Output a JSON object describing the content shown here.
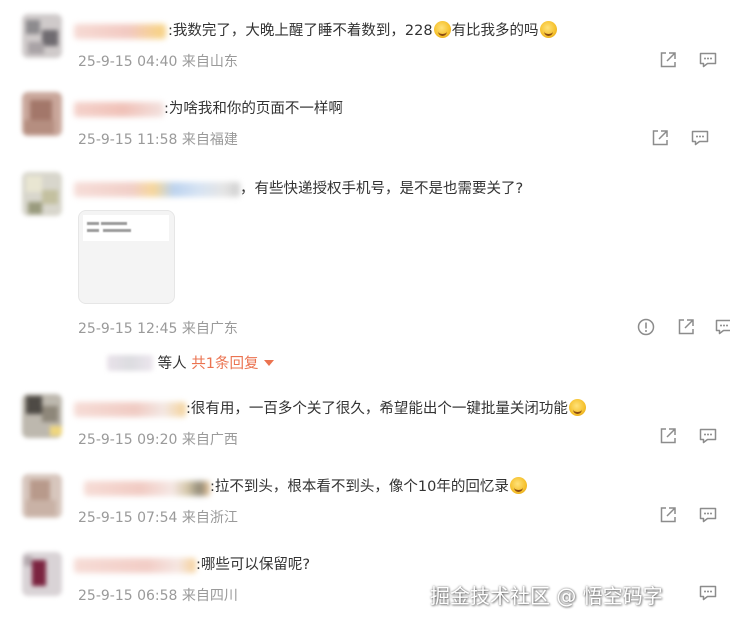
{
  "comments": [
    {
      "text": ":我数完了，大晚上醒了睡不着数到，228",
      "text_after_emoji": "有比我多的吗",
      "timestamp": "25-9-15 04:40",
      "location": "来自山东"
    },
    {
      "text": ":为啥我和你的页面不一样啊",
      "timestamp": "25-9-15 11:58",
      "location": "来自福建"
    },
    {
      "text": "，有些快递授权手机号，是不是也需要关了?",
      "timestamp": "25-9-15 12:45",
      "location": "来自广东"
    },
    {
      "text": ":很有用，一百多个关了很久，希望能出个一键批量关闭功能",
      "timestamp": "25-9-15 09:20",
      "location": "来自广西"
    },
    {
      "text": ":拉不到头，根本看不到头，像个10年的回忆录",
      "timestamp": "25-9-15 07:54",
      "location": "来自浙江"
    },
    {
      "text": ":哪些可以保留呢?",
      "timestamp": "25-9-15 06:58",
      "location": "来自四川"
    }
  ],
  "replies": {
    "prefix": "等人",
    "link": "共1条回复"
  },
  "watermark": "掘金技术社区 @ 悟空码字",
  "icons": {
    "share": "share-icon",
    "comment": "comment-icon",
    "report": "report-icon",
    "dropdown": "caret-down-icon"
  },
  "colors": {
    "reply_link": "#eb7350",
    "meta": "#9a9a9a",
    "text": "#333333"
  }
}
